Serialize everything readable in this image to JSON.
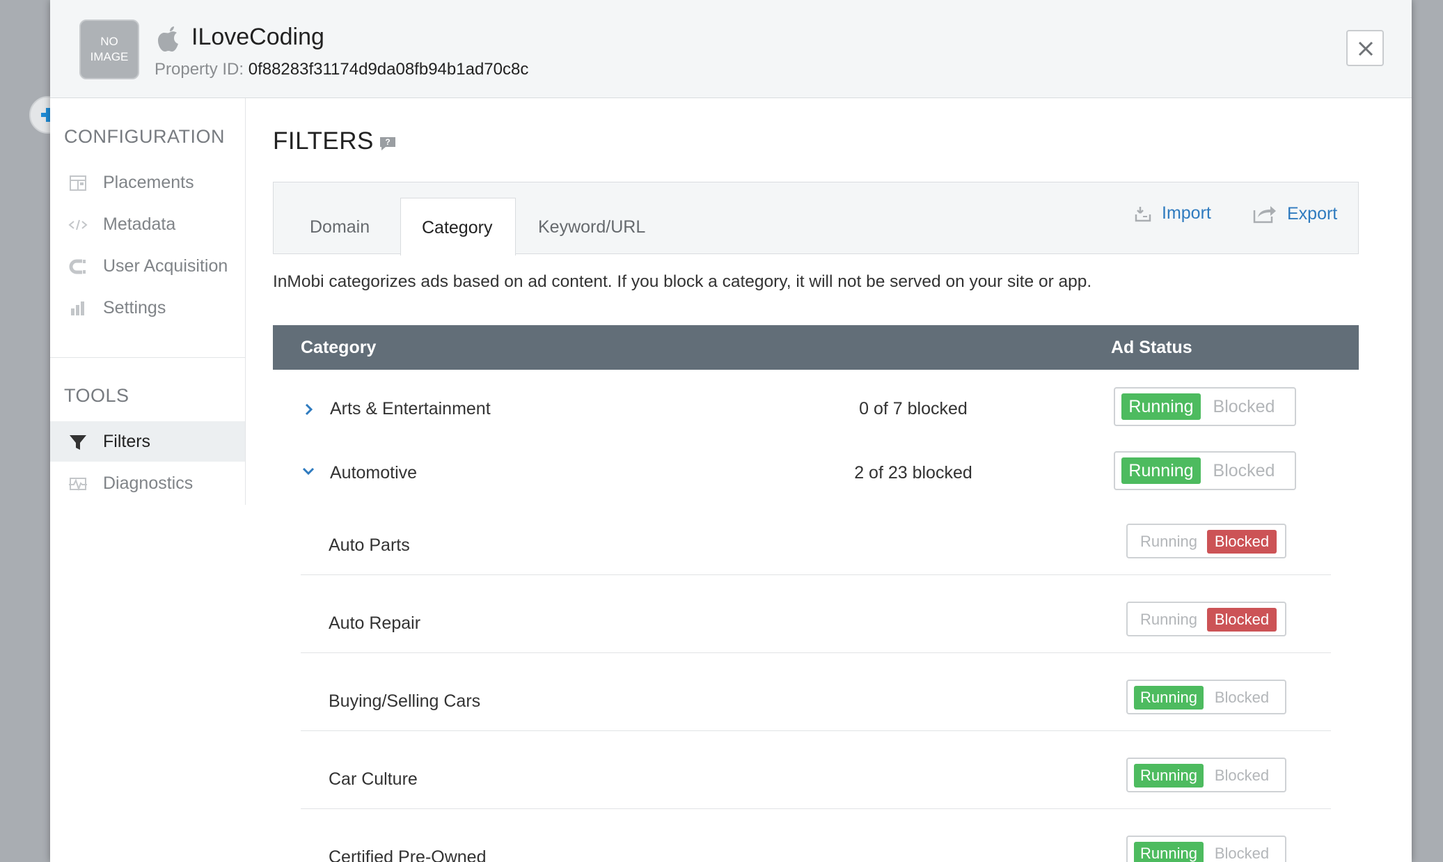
{
  "header": {
    "no_image": "NO IMAGE",
    "app_name": "ILoveCoding",
    "property_label": "Property ID:",
    "property_id": "0f88283f31174d9da08fb94b1ad70c8c",
    "platform_icon": "apple-icon"
  },
  "sidebar": {
    "configuration_heading": "CONFIGURATION",
    "config_items": [
      {
        "label": "Placements",
        "icon": "placements-icon"
      },
      {
        "label": "Metadata",
        "icon": "code-icon"
      },
      {
        "label": "User Acquisition",
        "icon": "magnet-icon"
      },
      {
        "label": "Settings",
        "icon": "bar-chart-icon"
      }
    ],
    "tools_heading": "TOOLS",
    "tool_items": [
      {
        "label": "Filters",
        "icon": "filter-icon",
        "active": true
      },
      {
        "label": "Diagnostics",
        "icon": "pulse-icon",
        "active": false
      }
    ]
  },
  "main": {
    "title": "FILTERS",
    "tabs": [
      {
        "label": "Domain",
        "active": false
      },
      {
        "label": "Category",
        "active": true
      },
      {
        "label": "Keyword/URL",
        "active": false
      }
    ],
    "import_label": "Import",
    "export_label": "Export",
    "description": "InMobi categorizes ads based on ad content. If you block a category, it will not be served on your site or app.",
    "table": {
      "col_category": "Category",
      "col_status": "Ad Status",
      "running_label": "Running",
      "blocked_label": "Blocked",
      "categories": [
        {
          "name": "Arts & Entertainment",
          "count": "0 of 7 blocked",
          "status": "Running",
          "expanded": false
        },
        {
          "name": "Automotive",
          "count": "2 of 23 blocked",
          "status": "Running",
          "expanded": true
        }
      ],
      "subcategories": [
        {
          "name": "Auto Parts",
          "status": "Blocked"
        },
        {
          "name": "Auto Repair",
          "status": "Blocked"
        },
        {
          "name": "Buying/Selling Cars",
          "status": "Running"
        },
        {
          "name": "Car Culture",
          "status": "Running"
        },
        {
          "name": "Certified Pre-Owned",
          "status": "Running"
        }
      ]
    }
  },
  "colors": {
    "running": "#4dbb5f",
    "blocked": "#cc5356",
    "table_header": "#626e78",
    "link": "#2f7bbf"
  }
}
